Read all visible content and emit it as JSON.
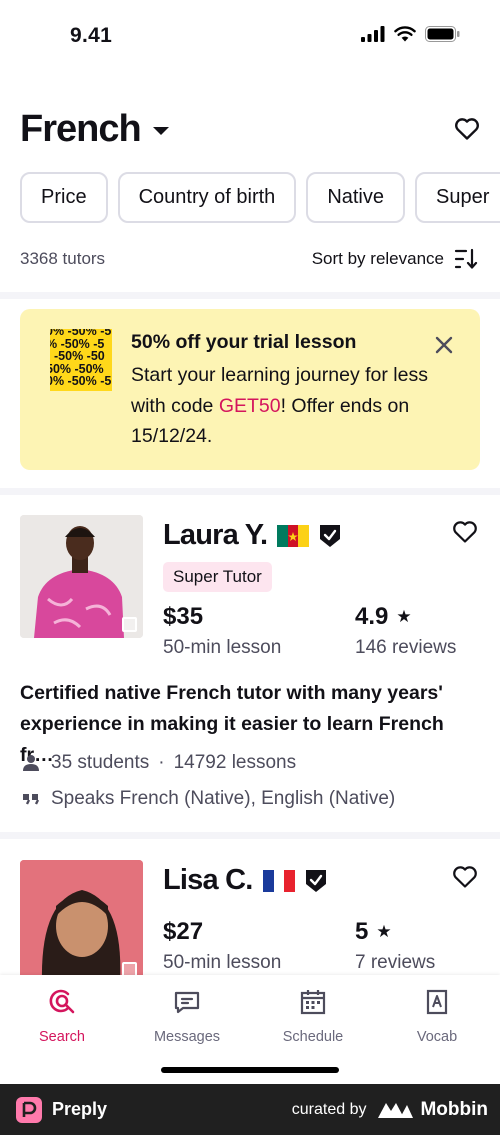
{
  "status_bar": {
    "time": "9.41"
  },
  "header": {
    "language": "French"
  },
  "filters": [
    "Price",
    "Country of birth",
    "Native",
    "Super"
  ],
  "results": {
    "count": "3368 tutors",
    "sort_label": "Sort by relevance"
  },
  "promo": {
    "image_text": [
      "0% -50% -5",
      "% -50% -5",
      "-50% -50",
      "50% -50%",
      "0% -50% -5"
    ],
    "title": "50% off your trial lesson",
    "body_prefix": "Start your learning journey for less with code ",
    "code": "GET50",
    "body_suffix": "! Offer ends on 15/12/24."
  },
  "tutors": [
    {
      "name": "Laura Y.",
      "flag": "cameroon",
      "badge": "Super Tutor",
      "price": "$35",
      "price_sub": "50-min lesson",
      "rating": "4.9",
      "reviews": "146 reviews",
      "description": "Certified native French tutor with many years' experience in making it easier to learn French fr…",
      "students": "35 students",
      "lessons": "14792 lessons",
      "speaks": "Speaks French (Native), English (Native)"
    },
    {
      "name": "Lisa C.",
      "flag": "france",
      "price": "$27",
      "price_sub": "50-min lesson",
      "rating": "5",
      "reviews": "7 reviews"
    }
  ],
  "nav": [
    {
      "label": "Search",
      "icon": "search-icon",
      "active": true
    },
    {
      "label": "Messages",
      "icon": "message-icon",
      "active": false
    },
    {
      "label": "Schedule",
      "icon": "calendar-icon",
      "active": false
    },
    {
      "label": "Vocab",
      "icon": "vocab-icon",
      "active": false
    }
  ],
  "footer": {
    "brand": "Preply",
    "curated_by": "curated by",
    "curator": "Mobbin"
  },
  "colors": {
    "accent": "#d4155d",
    "promo_bg": "#fdf4b4",
    "badge_bg": "#fde5ef",
    "text": "#121117",
    "muted": "#4d4c5c"
  }
}
